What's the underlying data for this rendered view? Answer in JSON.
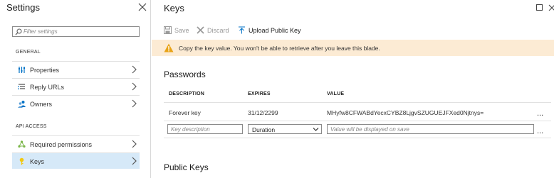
{
  "settings": {
    "title": "Settings",
    "filter_placeholder": "Filter settings",
    "general_label": "GENERAL",
    "api_access_label": "API ACCESS",
    "items": [
      {
        "label": "Properties",
        "icon": "properties-icon"
      },
      {
        "label": "Reply URLs",
        "icon": "list-icon"
      },
      {
        "label": "Owners",
        "icon": "people-icon"
      },
      {
        "label": "Required permissions",
        "icon": "network-icon"
      },
      {
        "label": "Keys",
        "icon": "key-icon"
      }
    ]
  },
  "keys": {
    "title": "Keys",
    "toolbar": {
      "save": "Save",
      "discard": "Discard",
      "upload": "Upload Public Key"
    },
    "warning": "Copy the key value. You won't be able to retrieve after you leave this blade.",
    "passwords_heading": "Passwords",
    "columns": {
      "description": "DESCRIPTION",
      "expires": "EXPIRES",
      "value": "VALUE"
    },
    "rows": [
      {
        "description": "Forever key",
        "expires": "31/12/2299",
        "value": "MHyfw8CFWABdYecxCYBZ8LjgvSZUGUEJFXed0Njtnys="
      }
    ],
    "new_row": {
      "description_placeholder": "Key description",
      "duration_value": "Duration",
      "value_placeholder": "Value will be displayed on save"
    },
    "more_glyph": "...",
    "public_keys_heading": "Public Keys"
  },
  "colors": {
    "selected_bg": "#d6e9f8",
    "warning_bg": "#fcebd4",
    "warning_icon": "#e8a317",
    "accent": "#0072c6"
  }
}
